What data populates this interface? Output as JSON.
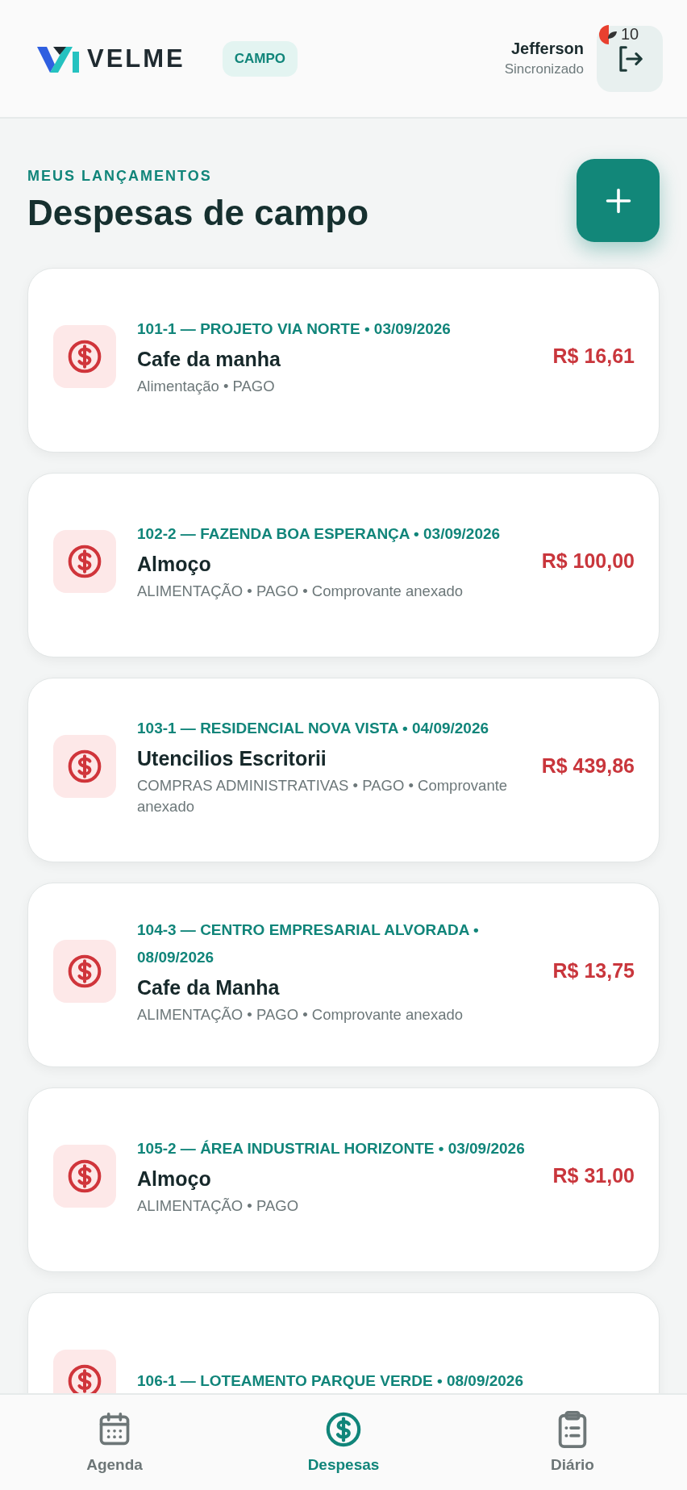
{
  "header": {
    "logo": "VELME",
    "mode_badge": "CAMPO",
    "user": {
      "name": "Jefferson",
      "status": "Sincronizado"
    },
    "notification_count": "10"
  },
  "section": {
    "eyebrow": "MEUS LANÇAMENTOS",
    "title": "Despesas de campo"
  },
  "expenses": [
    {
      "heading": "101-1 — PROJETO VIA NORTE • 03/09/2026",
      "title": "Cafe da manha",
      "details": "Alimentação • PAGO",
      "amount": "R$ 16,61"
    },
    {
      "heading": "102-2 — FAZENDA BOA ESPERANÇA • 03/09/2026",
      "title": "Almoço",
      "details": "ALIMENTAÇÃO • PAGO • Comprovante anexado",
      "amount": "R$ 100,00"
    },
    {
      "heading": "103-1 — RESIDENCIAL NOVA VISTA • 04/09/2026",
      "title": "Utencilios Escritorii",
      "details": "COMPRAS ADMINISTRATIVAS • PAGO • Comprovante anexado",
      "amount": "R$ 439,86"
    },
    {
      "heading": "104-3 — CENTRO EMPRESARIAL ALVORADA • 08/09/2026",
      "title": "Cafe da Manha",
      "details": "ALIMENTAÇÃO • PAGO • Comprovante anexado",
      "amount": "R$ 13,75"
    },
    {
      "heading": "105-2 — ÁREA INDUSTRIAL HORIZONTE • 03/09/2026",
      "title": "Almoço",
      "details": "ALIMENTAÇÃO • PAGO",
      "amount": "R$ 31,00"
    },
    {
      "heading": "106-1 — LOTEAMENTO PARQUE VERDE • 08/09/2026"
    }
  ],
  "nav": [
    {
      "kind": "calendar",
      "label": "Agenda",
      "selected": false
    },
    {
      "kind": "dollar",
      "label": "Despesas",
      "selected": true
    },
    {
      "kind": "clipboard",
      "label": "Diário",
      "selected": false
    }
  ]
}
